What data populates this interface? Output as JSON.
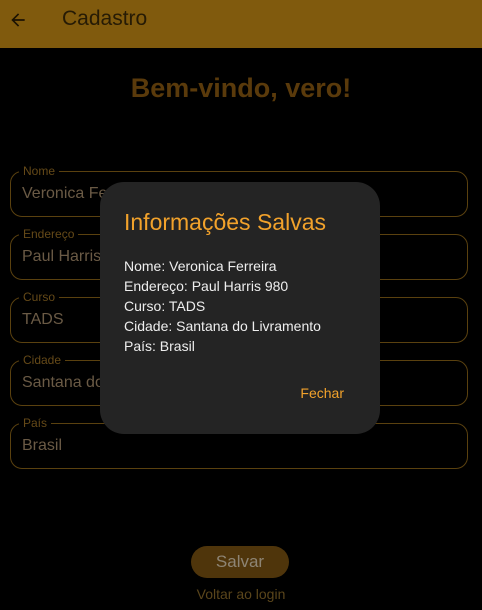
{
  "appbar": {
    "title": "Cadastro",
    "back_icon": "arrow-left-icon"
  },
  "welcome": "Bem-vindo, vero!",
  "fields": [
    {
      "label": "Nome",
      "value": "Veronica Ferreira"
    },
    {
      "label": "Endereço",
      "value": "Paul Harris 980"
    },
    {
      "label": "Curso",
      "value": "TADS"
    },
    {
      "label": "Cidade",
      "value": "Santana do Livramento"
    },
    {
      "label": "País",
      "value": "Brasil"
    }
  ],
  "save_label": "Salvar",
  "login_link": "Voltar ao login",
  "dialog": {
    "title": "Informações Salvas",
    "lines": [
      "Nome: Veronica Ferreira",
      "Endereço: Paul Harris 980",
      "Curso: TADS",
      "Cidade: Santana do Livramento",
      "País: Brasil"
    ],
    "close_label": "Fechar"
  },
  "colors": {
    "appbar": "#c58a15",
    "accent": "#f2a22b",
    "dialog_bg": "#242424"
  }
}
